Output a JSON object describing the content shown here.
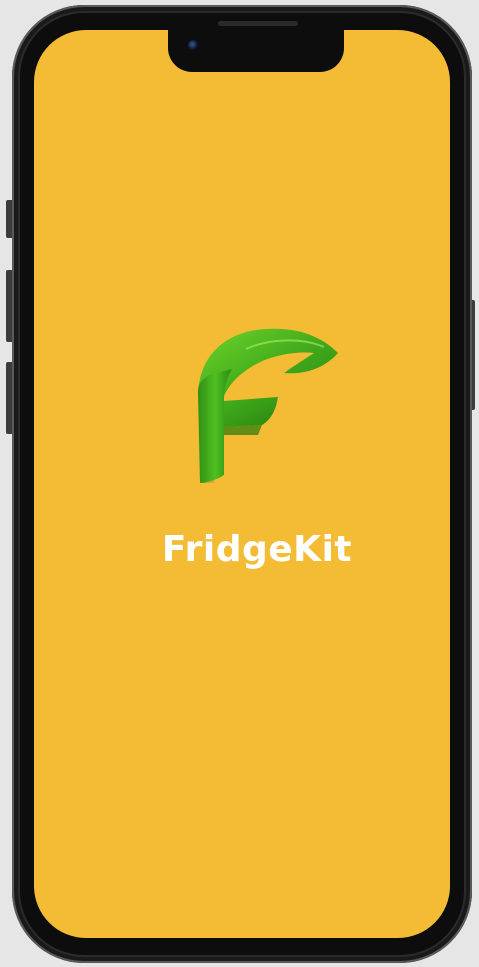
{
  "app": {
    "name": "FridgeKit",
    "logo_letter": "F"
  },
  "colors": {
    "screen_background": "#f3bc34",
    "logo_green": "#3fa81f",
    "app_name_text": "#ffffff",
    "device_frame": "#2b2b2b"
  },
  "icons": {
    "logo": "leaf-f-logo-icon"
  }
}
